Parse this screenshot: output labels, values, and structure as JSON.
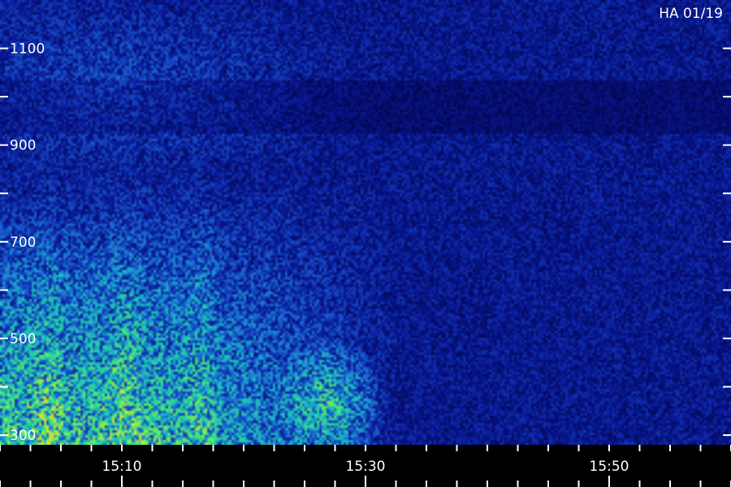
{
  "chart_data": {
    "type": "heatmap",
    "title": "HA 01/19",
    "x_tick_labels": [
      "15:10",
      "15:30",
      "15:50"
    ],
    "x_tick_minutes": [
      10,
      30,
      50
    ],
    "x_range_minutes": [
      0,
      60
    ],
    "y_tick_labels": [
      "1100",
      "900",
      "700",
      "500",
      "300"
    ],
    "y_tick_values": [
      1100,
      900,
      700,
      500,
      300
    ],
    "y_range": [
      280,
      1200
    ],
    "colormap": [
      "#00003a",
      "#0a1a9a",
      "#1a5cd0",
      "#19b5c8",
      "#2de08a",
      "#86f04a",
      "#f0e020"
    ],
    "background_color": "#0a0a50"
  }
}
